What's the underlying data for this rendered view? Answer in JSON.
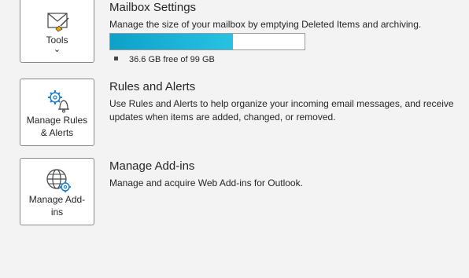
{
  "mailbox": {
    "tile_label": "Tools",
    "tile_chevron": "⌄",
    "title": "Mailbox Settings",
    "description": "Manage the size of your mailbox by emptying Deleted Items and archiving.",
    "quota_text": "36.6 GB free of 99 GB",
    "quota_used_fraction": 0.63,
    "icon": "mail-broom-icon"
  },
  "rules": {
    "tile_label_line1": "Manage Rules",
    "tile_label_line2": "& Alerts",
    "title": "Rules and Alerts",
    "description": "Use Rules and Alerts to help organize your incoming email messages, and receive updates when items are added, changed, or removed.",
    "icon": "gear-bell-icon"
  },
  "addins": {
    "tile_label_line1": "Manage Add-",
    "tile_label_line2": "ins",
    "title": "Manage Add-ins",
    "description": "Manage and acquire Web Add-ins for Outlook.",
    "icon": "globe-gear-icon"
  },
  "colors": {
    "accent": "#1aa9d1",
    "background": "#f3f3f3",
    "tile_border": "#8a8a8a"
  }
}
